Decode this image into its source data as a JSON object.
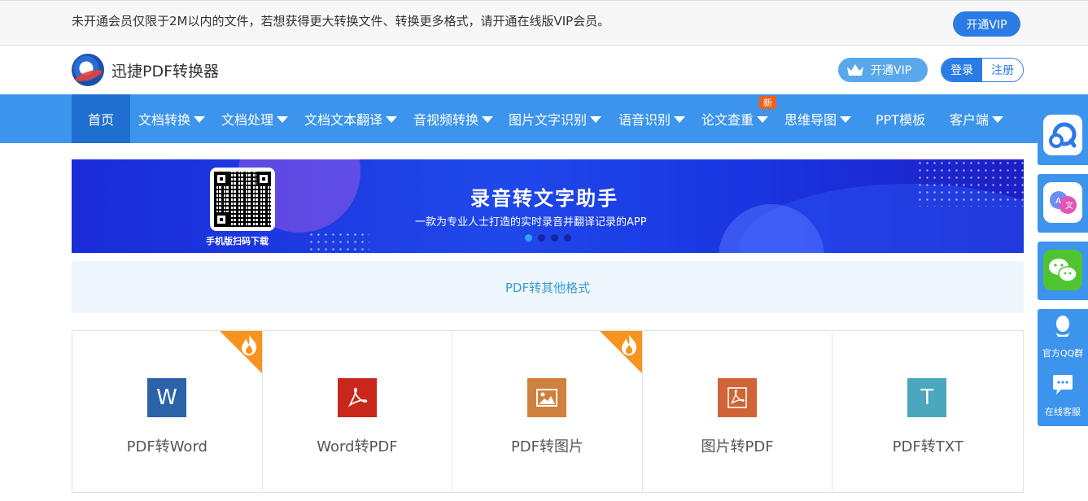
{
  "notice": {
    "text": "未开通会员仅限于2M以内的文件，若想获得更大转换文件、转换更多格式，请开通在线版VIP会员。",
    "button": "开通VIP"
  },
  "header": {
    "brand": "迅捷PDF转换器",
    "vip": "开通VIP",
    "login": "登录",
    "register": "注册"
  },
  "nav": {
    "items": [
      {
        "label": "首页"
      },
      {
        "label": "文档转换"
      },
      {
        "label": "文档处理"
      },
      {
        "label": "文档文本翻译"
      },
      {
        "label": "音视频转换"
      },
      {
        "label": "图片文字识别"
      },
      {
        "label": "语音识别"
      },
      {
        "label": "论文查重"
      },
      {
        "label": "思维导图"
      },
      {
        "label": "PPT模板"
      },
      {
        "label": "客户端"
      }
    ],
    "new_badge": "新"
  },
  "banner": {
    "title": "录音转文字助手",
    "subtitle": "一款为专业人士打造的实时录音并翻译记录的APP",
    "qr_caption": "手机版扫码下载"
  },
  "section": {
    "title": "PDF转其他格式"
  },
  "cards": [
    {
      "label": "PDF转Word",
      "glyph": "W",
      "color": "#2b62a8",
      "hot": true
    },
    {
      "label": "Word转PDF",
      "glyph": "",
      "color": "#c9261c",
      "hot": false
    },
    {
      "label": "PDF转图片",
      "glyph": "",
      "color": "#d0803d",
      "hot": true
    },
    {
      "label": "图片转PDF",
      "glyph": "",
      "color": "#d06436",
      "hot": false
    },
    {
      "label": "PDF转TXT",
      "glyph": "T",
      "color": "#4aa7bd",
      "hot": false
    }
  ],
  "side": {
    "qq_group": "官方QQ群",
    "online_service": "在线客服"
  },
  "colors": {
    "primary": "#3c94ec",
    "primary_dark": "#1f6fd0",
    "accent_orange": "#f7931e"
  }
}
